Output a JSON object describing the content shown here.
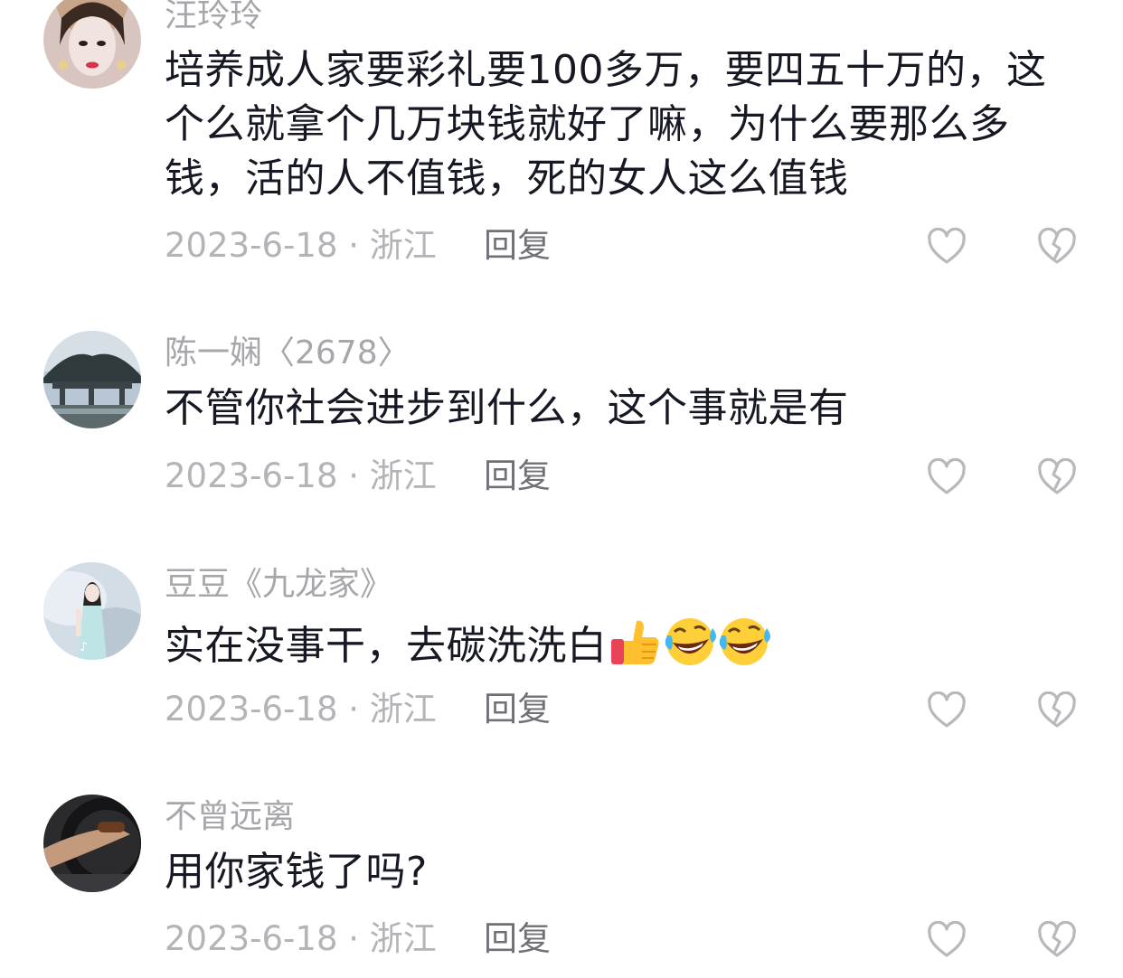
{
  "comments": [
    {
      "username": "汪玲玲",
      "content_lines": [
        "培养成人家要彩礼要100多万，要四五十万的，这",
        "个么就拿个几万块钱就好了嘛，为什么要那么多",
        "钱，活的人不值钱，死的女人这么值钱"
      ],
      "date_location": "2023-6-18 · 浙江",
      "reply_label": "回复"
    },
    {
      "username": "陈一娴〈2678〉",
      "content_lines": [
        "不管你社会进步到什么，这个事就是有"
      ],
      "date_location": "2023-6-18 · 浙江",
      "reply_label": "回复"
    },
    {
      "username": "豆豆《九龙家》",
      "content_lines": [
        "实在没事干，去碳洗洗白"
      ],
      "emojis": [
        "thumbs-up",
        "rolling-laughing",
        "rolling-laughing"
      ],
      "date_location": "2023-6-18 · 浙江",
      "reply_label": "回复"
    },
    {
      "username": "不曾远离",
      "content_lines": [
        "用你家钱了吗?"
      ],
      "date_location": "2023-6-18 · 浙江",
      "reply_label": "回复"
    }
  ],
  "icons": {
    "like": "heart-outline-icon",
    "dislike": "broken-heart-outline-icon"
  },
  "colors": {
    "username": "#a6a6ab",
    "content": "#161823",
    "meta": "#b3b3b8",
    "reply": "#707078",
    "icon_stroke": "#b8b8bd"
  }
}
